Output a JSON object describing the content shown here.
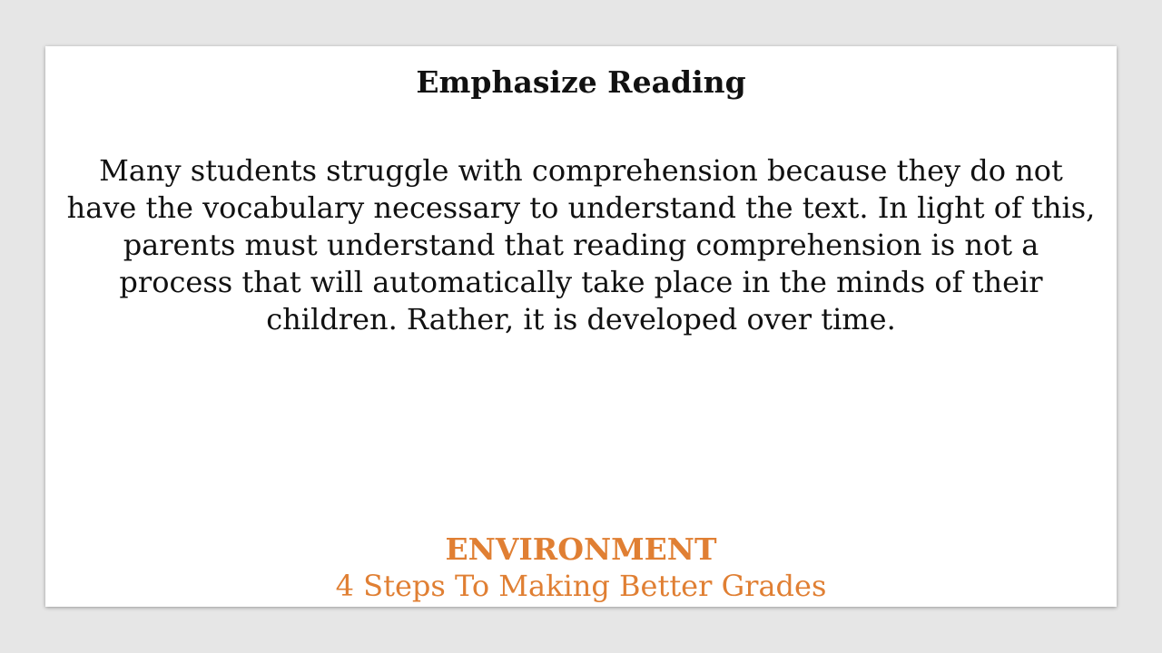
{
  "slide": {
    "title": "Emphasize Reading",
    "body": "Many students struggle with comprehension because they do not have the vocabulary necessary to understand the text. In light of this, parents must understand that reading comprehension is not a process that will automatically take place in the minds of their children. Rather, it is developed over time.",
    "footer_heading": "ENVIRONMENT",
    "footer_subheading": "4 Steps To Making Better Grades"
  },
  "colors": {
    "background": "#e6e6e6",
    "slide": "#ffffff",
    "text": "#111111",
    "accent": "#e07f33"
  }
}
